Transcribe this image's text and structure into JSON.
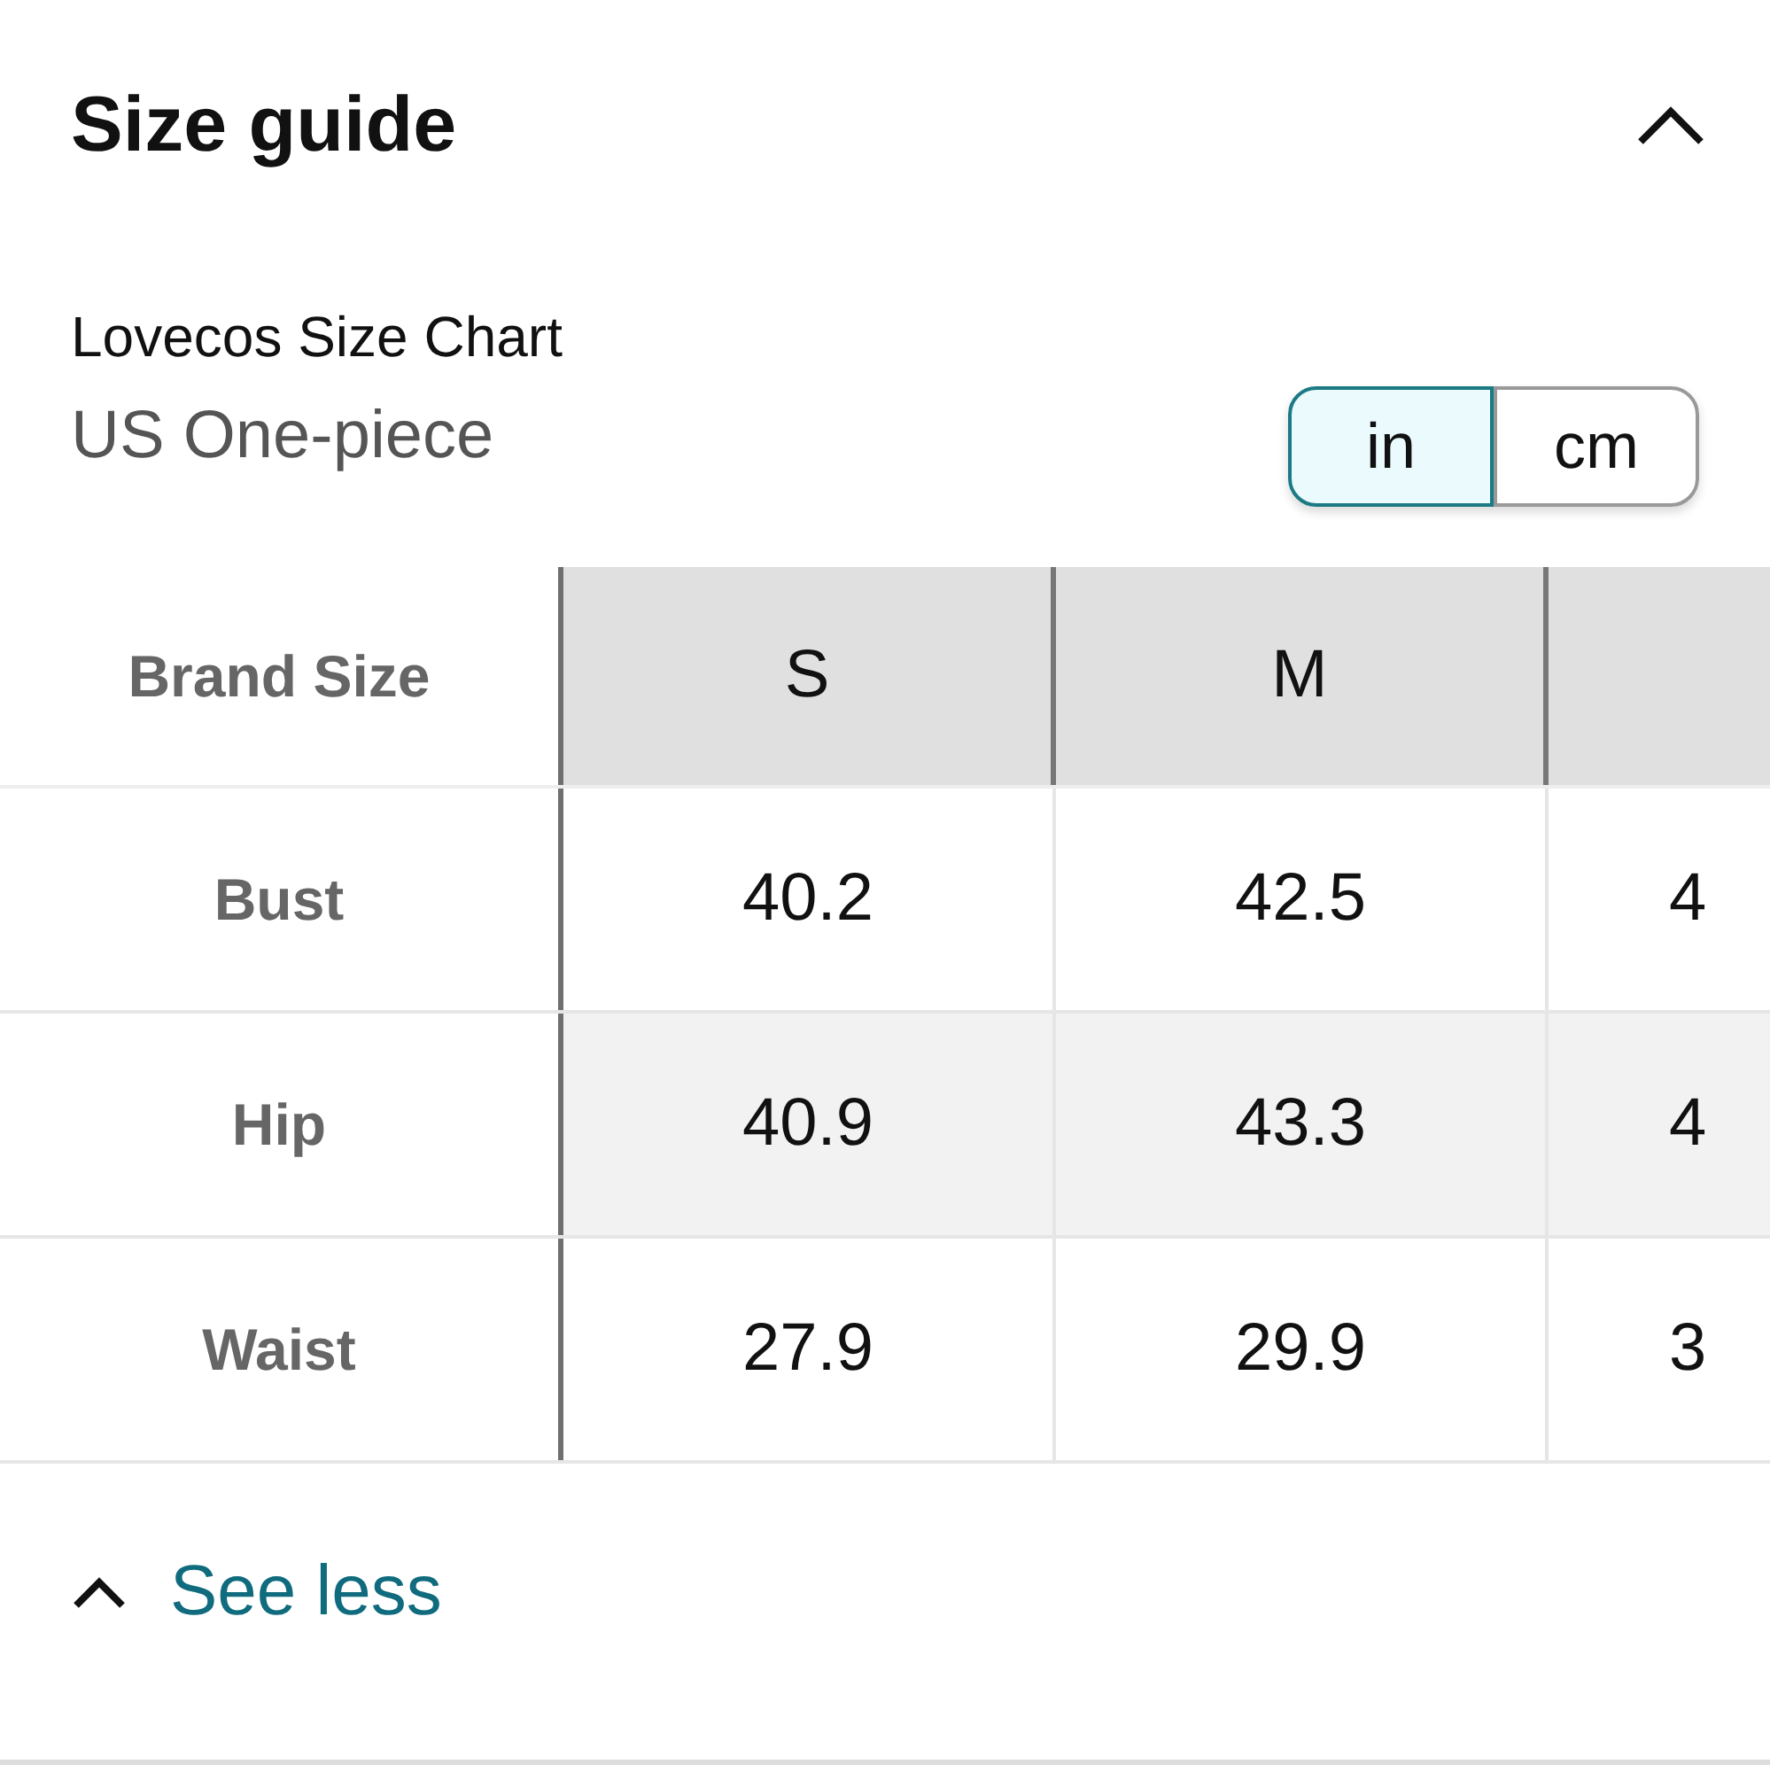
{
  "section": {
    "title": "Size guide",
    "expanded": true
  },
  "chart": {
    "brand": "Lovecos Size Chart",
    "subtitle": "US One-piece"
  },
  "units": [
    {
      "label": "in",
      "selected": true
    },
    {
      "label": "cm",
      "selected": false
    }
  ],
  "table": {
    "header_label": "Brand Size",
    "columns": [
      "S",
      "M"
    ],
    "rows": [
      {
        "label": "Bust",
        "cells": [
          "40.2",
          "42.5",
          "4"
        ]
      },
      {
        "label": "Hip",
        "cells": [
          "40.9",
          "43.3",
          "4"
        ]
      },
      {
        "label": "Waist",
        "cells": [
          "27.9",
          "29.9",
          "3"
        ]
      }
    ]
  },
  "see_less": "See less"
}
